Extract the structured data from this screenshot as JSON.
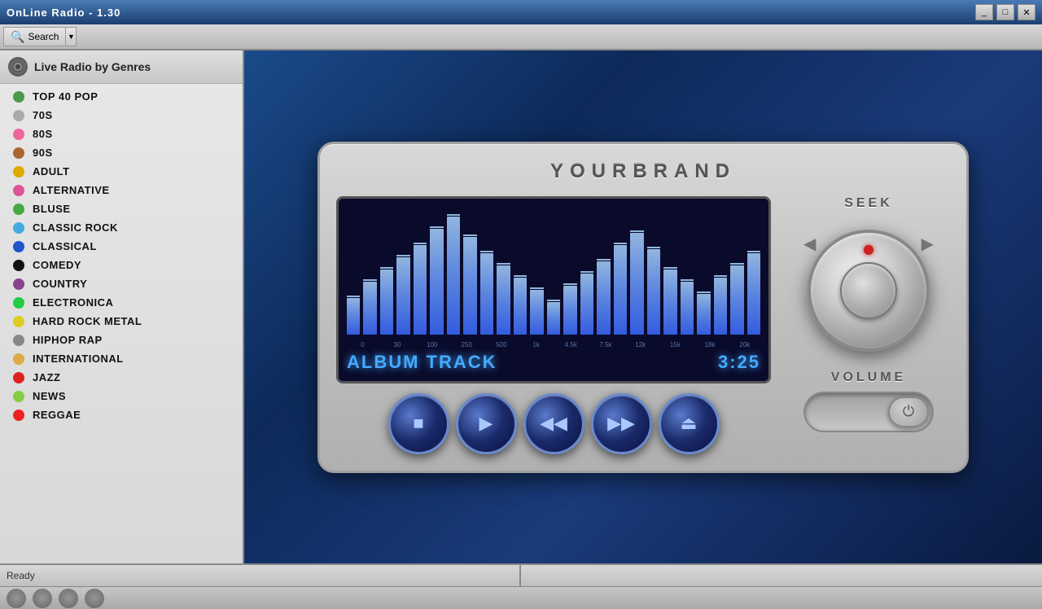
{
  "titlebar": {
    "title": "OnLine Radio - 1.30",
    "minimize": "_",
    "maximize": "□",
    "close": "✕"
  },
  "toolbar": {
    "search_label": "Search",
    "dropdown": "▼",
    "search_icon": "🔍"
  },
  "left_panel": {
    "title": "Live Radio by Genres",
    "genres": [
      {
        "name": "TOP 40 POP",
        "color": "#4a9a4a"
      },
      {
        "name": "70S",
        "color": "#aaaaaa"
      },
      {
        "name": "80S",
        "color": "#ee6699"
      },
      {
        "name": "90S",
        "color": "#aa6633"
      },
      {
        "name": "ADULT",
        "color": "#ddaa00"
      },
      {
        "name": "ALTERNATIVE",
        "color": "#dd5599"
      },
      {
        "name": "BLUSE",
        "color": "#44aa44"
      },
      {
        "name": "CLASSIC ROCK",
        "color": "#44aadd"
      },
      {
        "name": "CLASSICAL",
        "color": "#2255cc"
      },
      {
        "name": "COMEDY",
        "color": "#111111"
      },
      {
        "name": "COUNTRY",
        "color": "#884488"
      },
      {
        "name": "ELECTRONICA",
        "color": "#22cc44"
      },
      {
        "name": "HARD ROCK METAL",
        "color": "#ddcc22"
      },
      {
        "name": "HIPHOP RAP",
        "color": "#888888"
      },
      {
        "name": "INTERNATIONAL",
        "color": "#ddaa44"
      },
      {
        "name": "JAZZ",
        "color": "#dd2222"
      },
      {
        "name": "NEWS",
        "color": "#88cc44"
      },
      {
        "name": "REGGAE",
        "color": "#ee2222"
      }
    ]
  },
  "radio": {
    "brand": "YOURBRAND",
    "seek_label": "SEEK",
    "volume_label": "VOLUME",
    "track_name": "ALBUM TRACK",
    "track_time": "3:25",
    "eq_labels": [
      "0",
      "30",
      "100",
      "250",
      "500",
      "1k",
      "4.5k",
      "7.5k",
      "12k",
      "15k",
      "18k",
      "20k"
    ],
    "eq_heights": [
      45,
      65,
      80,
      95,
      110,
      130,
      145,
      120,
      100,
      85,
      70,
      55,
      40,
      60,
      75,
      90,
      110,
      125,
      105,
      80,
      65,
      50,
      70,
      85,
      100
    ]
  },
  "status": {
    "left": "Ready",
    "right": ""
  },
  "buttons": {
    "stop": "■",
    "play": "▶",
    "rewind": "◀◀",
    "fast_forward": "▶▶",
    "eject": "⏏"
  }
}
